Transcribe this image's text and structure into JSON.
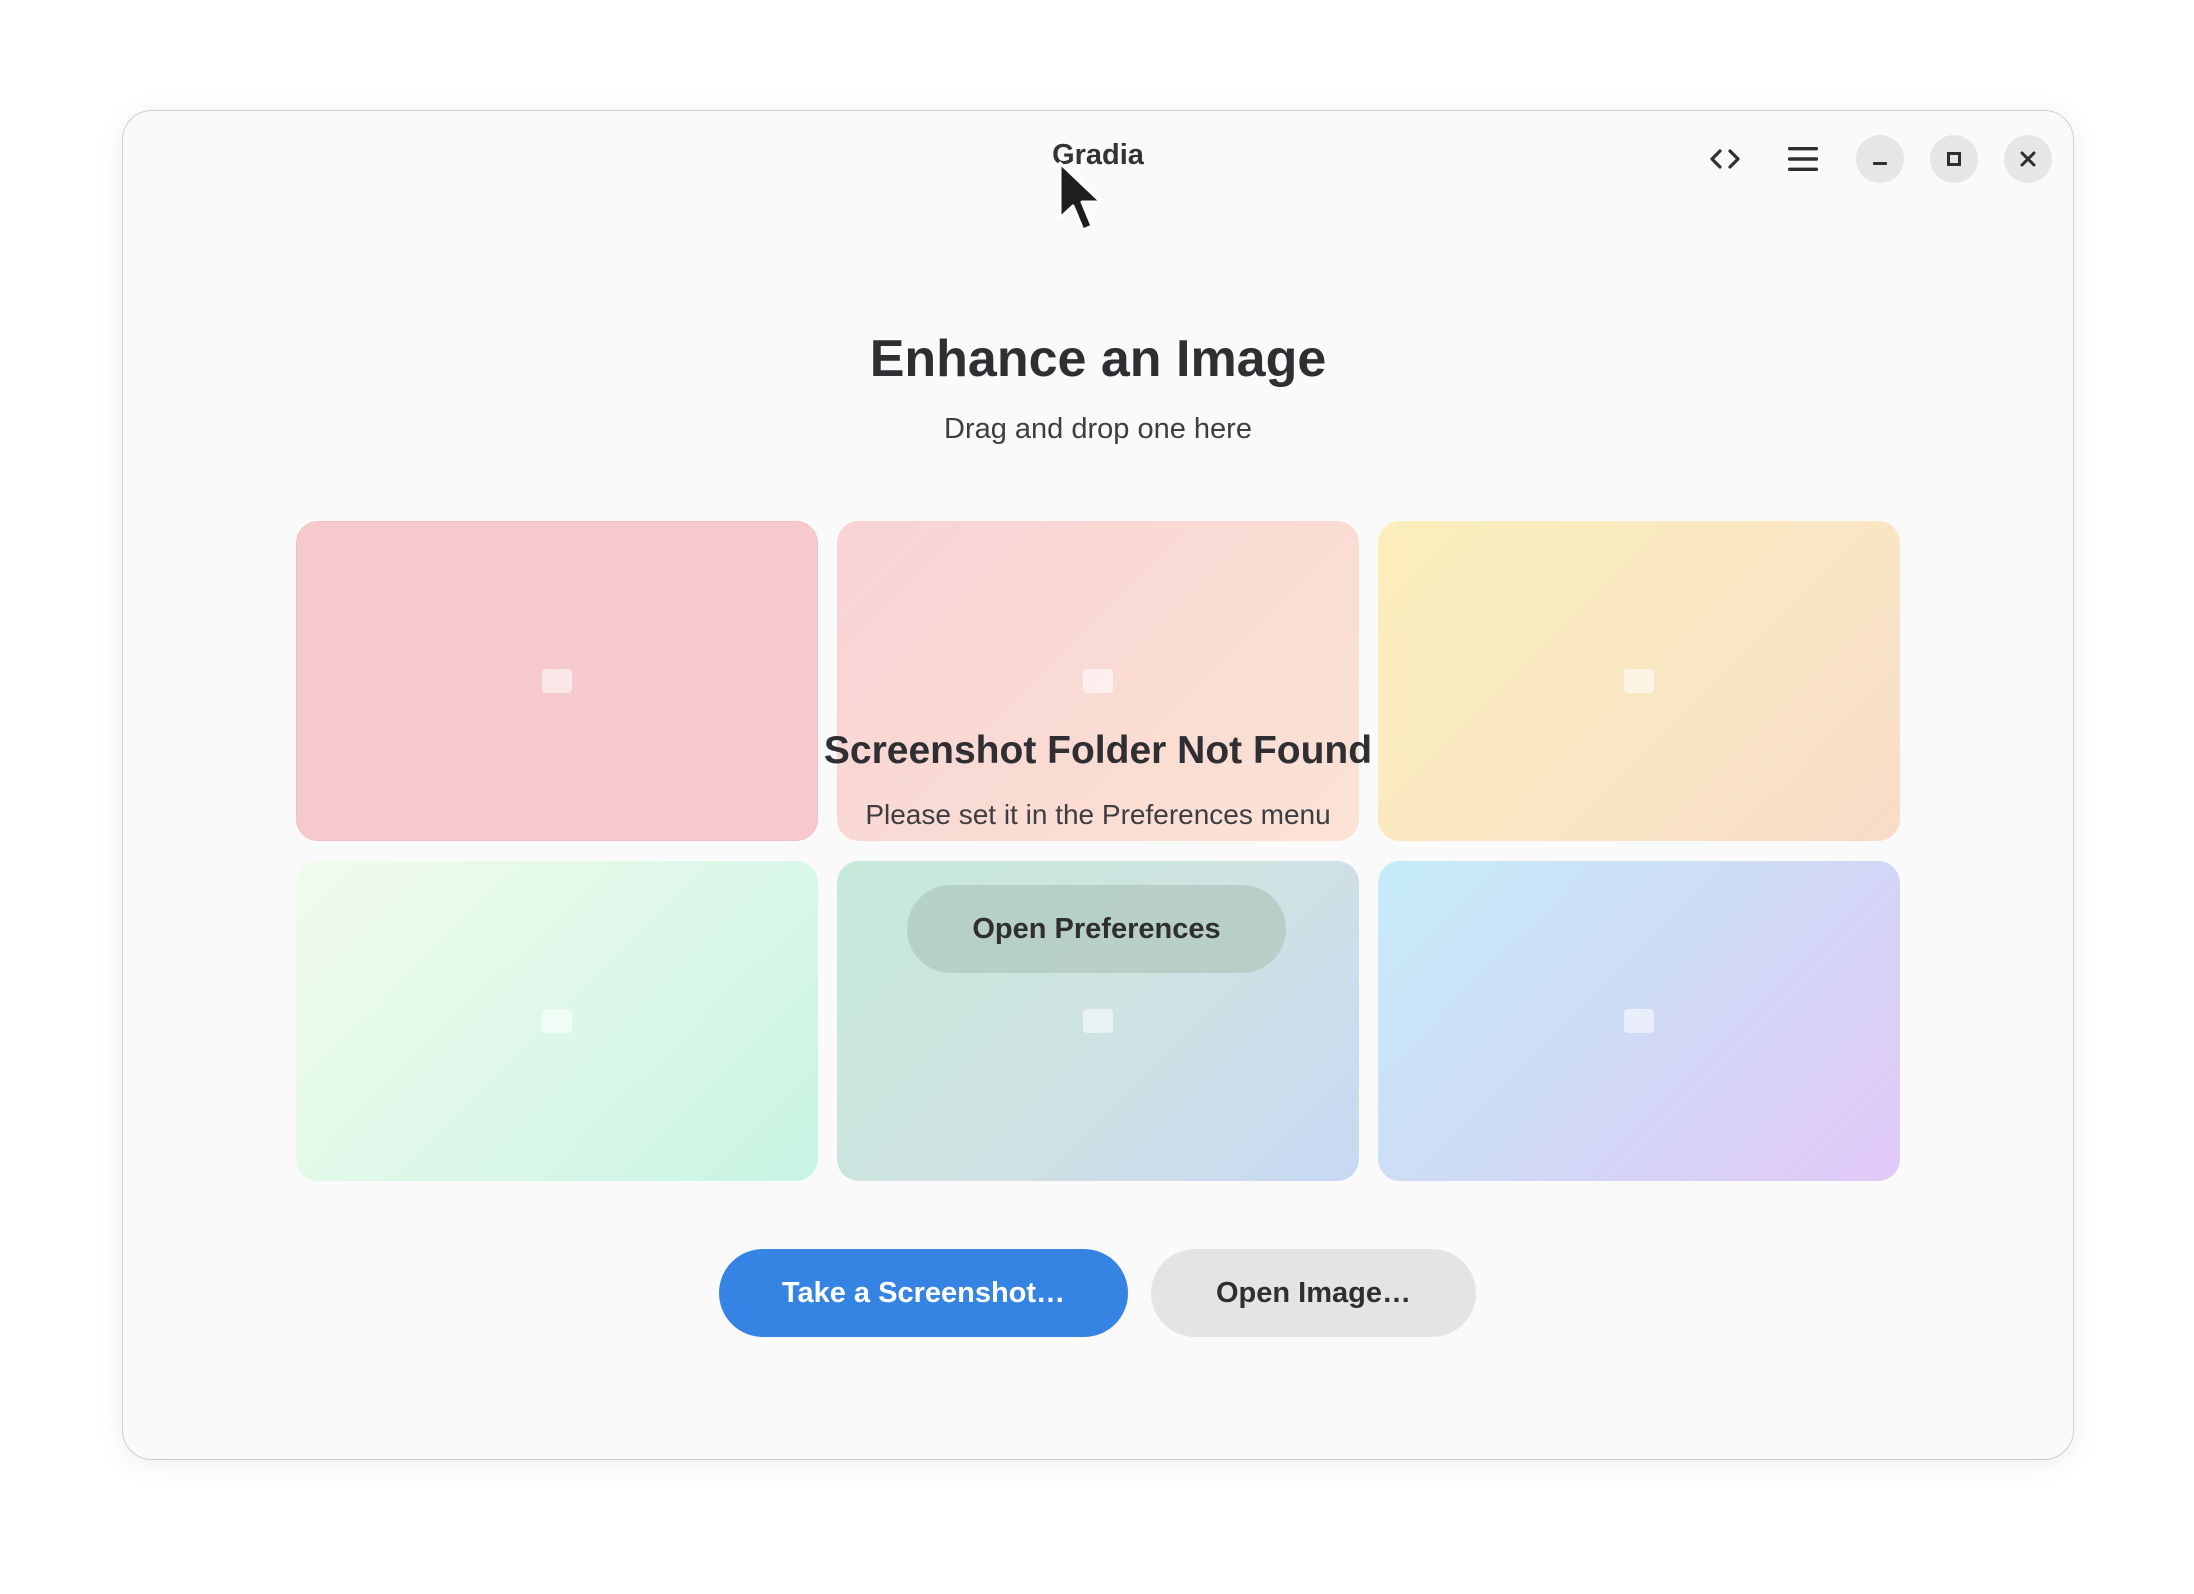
{
  "window": {
    "title": "Gradia",
    "controls": {
      "source_icon": "code-icon",
      "menu_icon": "hamburger-menu-icon",
      "minimize_icon": "minimize-icon",
      "maximize_icon": "maximize-icon",
      "close_icon": "close-icon"
    }
  },
  "main": {
    "heading": "Enhance an Image",
    "subheading": "Drag and drop one here"
  },
  "status": {
    "title": "Screenshot Folder Not Found",
    "description": "Please set it in the Preferences menu",
    "action_label": "Open Preferences"
  },
  "actions": {
    "take_screenshot_label": "Take a Screenshot…",
    "open_image_label": "Open Image…"
  },
  "colors": {
    "accent": "#3584e4",
    "window_bg": "#fafafa",
    "text": "#2e2e33"
  }
}
